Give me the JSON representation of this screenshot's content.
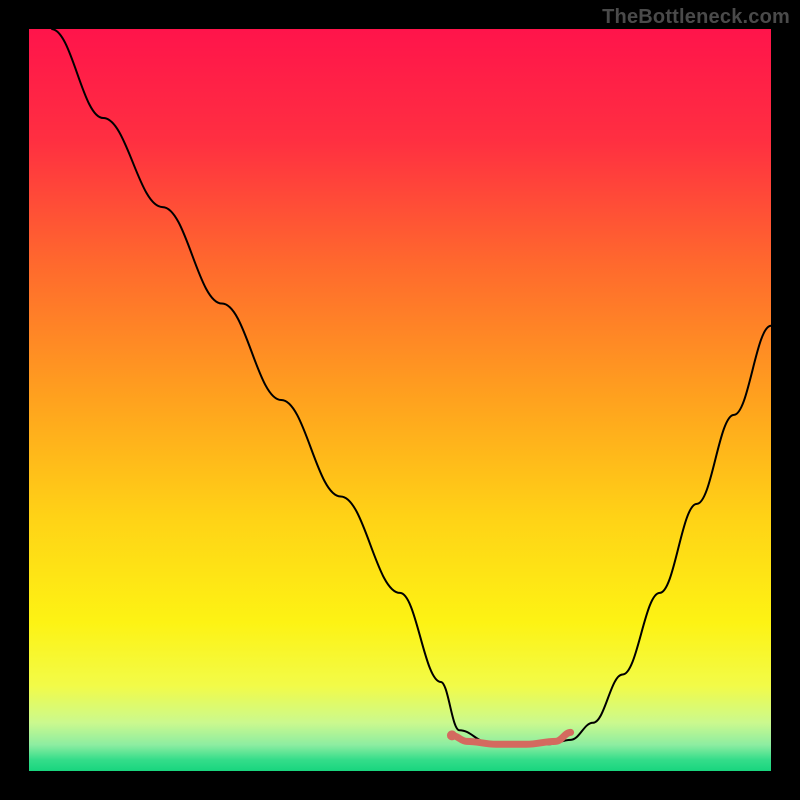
{
  "attribution": "TheBottleneck.com",
  "chart_data": {
    "type": "line",
    "title": "",
    "xlabel": "",
    "ylabel": "",
    "xlim": [
      0,
      100
    ],
    "ylim": [
      0,
      100
    ],
    "grid": false,
    "legend": false,
    "background_gradient": {
      "stops": [
        {
          "offset": 0.0,
          "color": "#ff144b"
        },
        {
          "offset": 0.15,
          "color": "#ff2f41"
        },
        {
          "offset": 0.32,
          "color": "#ff6a2d"
        },
        {
          "offset": 0.5,
          "color": "#ffa21e"
        },
        {
          "offset": 0.66,
          "color": "#ffd316"
        },
        {
          "offset": 0.8,
          "color": "#fdf314"
        },
        {
          "offset": 0.885,
          "color": "#f2fb48"
        },
        {
          "offset": 0.935,
          "color": "#cbf98e"
        },
        {
          "offset": 0.965,
          "color": "#8ceda1"
        },
        {
          "offset": 0.985,
          "color": "#34dd8a"
        },
        {
          "offset": 1.0,
          "color": "#18d57e"
        }
      ]
    },
    "series": [
      {
        "name": "bottleneck-curve",
        "stroke": "#000000",
        "stroke_width": 2,
        "x": [
          3,
          10,
          18,
          26,
          34,
          42,
          50,
          55.5,
          58,
          62,
          66,
          70,
          73,
          76,
          80,
          85,
          90,
          95,
          100
        ],
        "y": [
          100,
          88,
          76,
          63,
          50,
          37,
          24,
          12,
          5.5,
          3.8,
          3.5,
          3.6,
          4.2,
          6.5,
          13,
          24,
          36,
          48,
          60
        ]
      },
      {
        "name": "optimal-marker",
        "stroke": "#d46a5f",
        "stroke_width": 7,
        "linecap": "round",
        "x": [
          57,
          59,
          63,
          67,
          71,
          73
        ],
        "y": [
          4.8,
          4.0,
          3.6,
          3.6,
          4.0,
          5.2
        ]
      }
    ],
    "marker_dot": {
      "x": 57,
      "y": 4.8,
      "r": 5,
      "fill": "#d46a5f"
    }
  }
}
